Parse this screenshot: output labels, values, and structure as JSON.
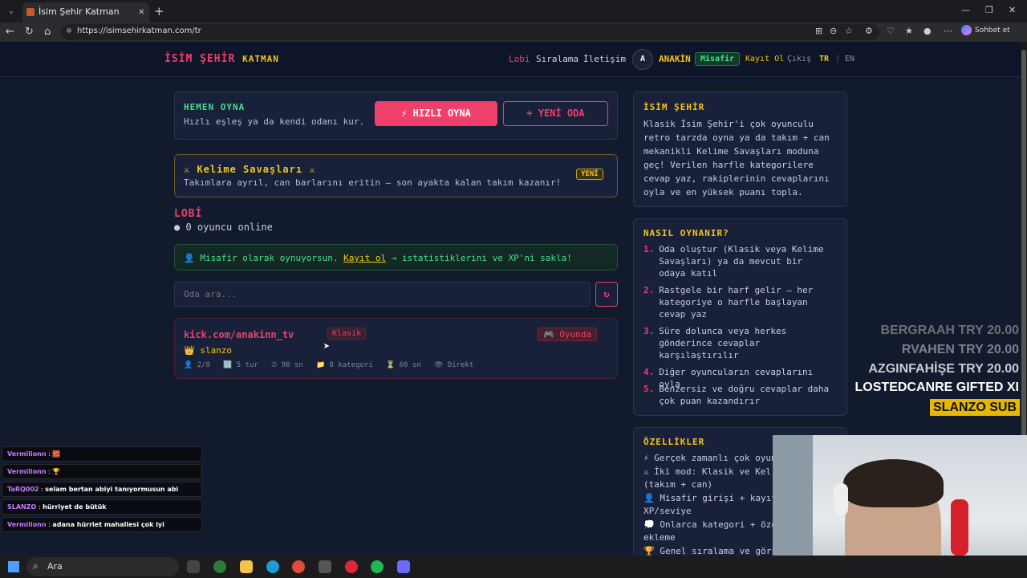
{
  "browser": {
    "tab_title": "İsim Şehir Katman",
    "url": "https://isimsehirkatman.com/tr",
    "copilot_label": "Sohbet et"
  },
  "header": {
    "logo_main": "İSİM ŞEHİR",
    "logo_sub": "KATMAN",
    "nav": [
      "Lobi",
      "Sıralama",
      "İletişim"
    ],
    "avatar_letter": "A",
    "username": "ANAKİN",
    "guest_badge": "Misafir",
    "register": "Kayıt Ol",
    "logout": "Çıkış",
    "lang_tr": "TR",
    "lang_sep": "|",
    "lang_en": "EN"
  },
  "quickplay": {
    "title": "HEMEN OYNA",
    "desc": "Hızlı eşleş ya da kendi odanı kur.",
    "quick_btn": "⚡ HIZLI OYNA",
    "new_room_btn": "+ YENİ ODA"
  },
  "wordwars": {
    "title": "⚔ Kelime Savaşları ⚔",
    "desc": "Takımlara ayrıl, can barlarını eritin — son ayakta kalan takım kazanır!",
    "badge": "YENİ"
  },
  "lobby": {
    "title": "LOBİ",
    "online": "● 0 oyuncu online",
    "guest_notice_pre": "👤 Misafir olarak oynuyorsun.",
    "guest_notice_link": "Kayıt ol",
    "guest_notice_post": "→ istatistiklerini ve XP'ni sakla!",
    "search_placeholder": "Oda ara...",
    "refresh": "↻"
  },
  "room": {
    "name": "kick.com/anakinn_tv",
    "mode": "Klasik",
    "status": "🎮 Oyunda",
    "host": "👑 slanzo",
    "meta": [
      "👤 2/8",
      "🔢 5 tur",
      "⏱ 90 sn",
      "📁 8 kategori",
      "⏳ 60 sn",
      "👁 Direkt"
    ]
  },
  "about": {
    "title": "İSİM ŞEHİR",
    "text": "Klasik İsim Şehir'i çok oyunculu retro tarzda oyna ya da takım + can mekanikli Kelime Savaşları moduna geç! Verilen harfle kategorilere cevap yaz, rakiplerinin cevaplarını oyla ve en yüksek puanı topla."
  },
  "howto": {
    "title": "NASIL OYNANIR?",
    "steps": [
      {
        "n": "1.",
        "t": "Oda oluştur (Klasik veya Kelime Savaşları) ya da mevcut bir odaya katıl"
      },
      {
        "n": "2.",
        "t": "Rastgele bir harf gelir — her kategoriye o harfle başlayan cevap yaz"
      },
      {
        "n": "3.",
        "t": "Süre dolunca veya herkes gönderince cevaplar karşılaştırılır"
      },
      {
        "n": "4.",
        "t": "Diğer oyuncuların cevaplarını oyla"
      },
      {
        "n": "5.",
        "t": "Benzersiz ve doğru cevaplar daha çok puan kazandırır"
      }
    ]
  },
  "features": {
    "title": "ÖZELLİKLER",
    "items": [
      "⚡ Gerçek zamanlı çok oyun",
      "⚔ İki mod: Klasik ve Kel",
      "(takım + can)",
      "👤 Misafir girişi + kayıtl",
      "XP/seviye",
      "💭 Onlarca kategori + özel",
      "ekleme",
      "🏆 Genel sıralama ve görse"
    ]
  },
  "chat": [
    {
      "user": "Vermilionn",
      "msg": "🧱",
      "color": "#c57bff"
    },
    {
      "user": "Vermilionn",
      "msg": "🏆",
      "color": "#c57bff"
    },
    {
      "user": "TaRQ002",
      "msg": "selam bertan abiyi tanıyormusun abi",
      "color": "#c57bff"
    },
    {
      "user": "SLANZO",
      "msg": "hürriyet de bütük",
      "color": "#c57bff"
    },
    {
      "user": "Vermilionn",
      "msg": "adana hürriet mahallesi çok iyi",
      "color": "#c57bff"
    }
  ],
  "donations": [
    {
      "name": "BERGRAAH",
      "amount": "TRY 20.00"
    },
    {
      "name": "RVAHEN",
      "amount": "TRY 20.00"
    },
    {
      "name": "AZGINFAHİŞE",
      "amount": "TRY 20.00"
    },
    {
      "name": "LOSTEDCANRE",
      "amount": "GIFTED XI"
    },
    {
      "name": "SLANZO",
      "amount": "SUB"
    }
  ],
  "taskbar": {
    "search": "Ara"
  }
}
